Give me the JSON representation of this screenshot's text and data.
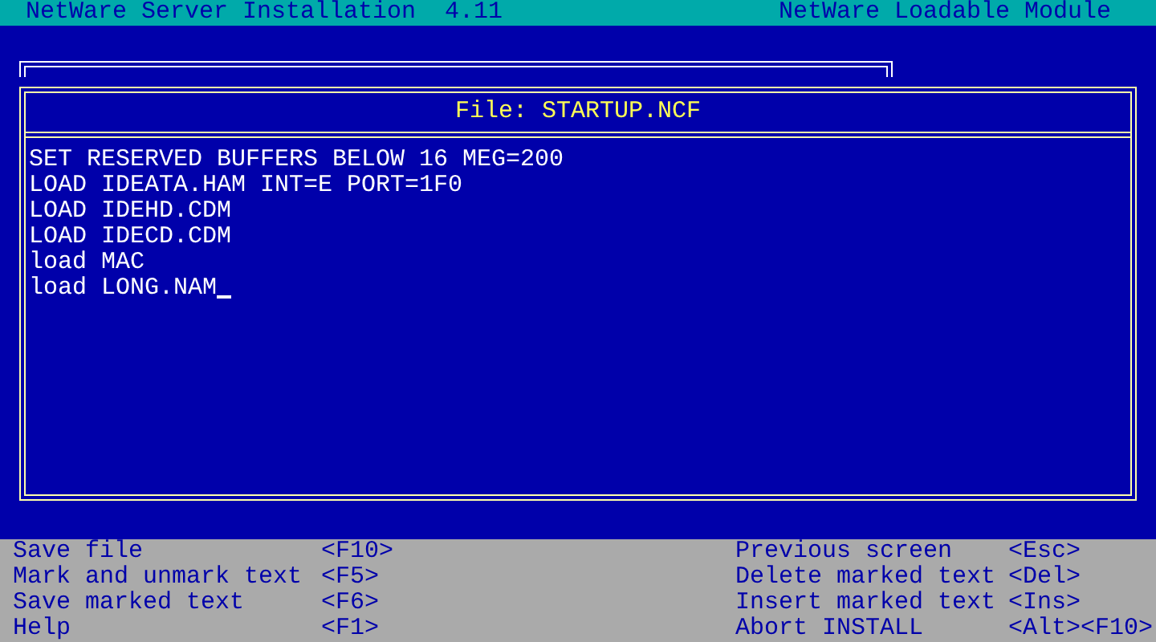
{
  "header": {
    "title": "NetWare Server Installation  4.11",
    "module": "NetWare Loadable Module"
  },
  "editor": {
    "title": "File: STARTUP.NCF",
    "lines": [
      "SET RESERVED BUFFERS BELOW 16 MEG=200",
      "LOAD IDEATA.HAM INT=E PORT=1F0",
      "LOAD IDEHD.CDM",
      "LOAD IDECD.CDM",
      "load MAC",
      "load LONG.NAM"
    ],
    "cursor_visible": true
  },
  "help_left": [
    {
      "label": "Save file",
      "key": "<F10>"
    },
    {
      "label": "Mark and unmark text",
      "key": "<F5>"
    },
    {
      "label": "Save marked text",
      "key": "<F6>"
    },
    {
      "label": "Help",
      "key": "<F1>"
    }
  ],
  "help_right": [
    {
      "label": "Previous screen",
      "key": "<Esc>"
    },
    {
      "label": "Delete marked text",
      "key": "<Del>"
    },
    {
      "label": "Insert marked text",
      "key": "<Ins>"
    },
    {
      "label": "Abort INSTALL",
      "key": "<Alt><F10>"
    }
  ]
}
